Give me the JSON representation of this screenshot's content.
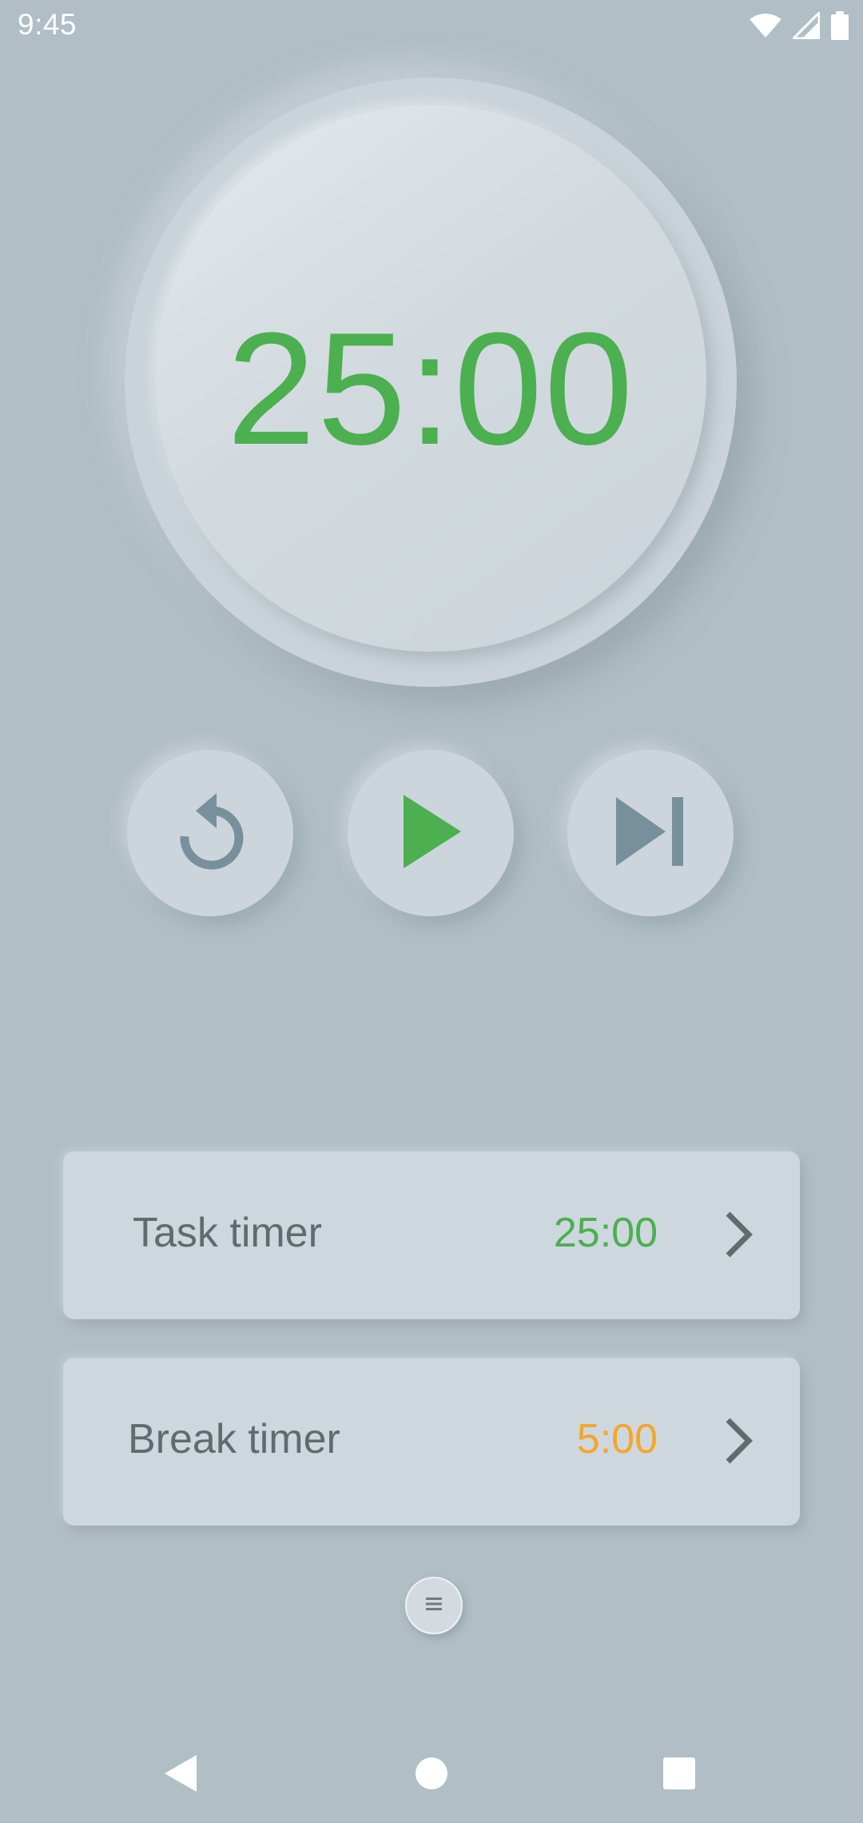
{
  "status_bar": {
    "time": "9:45",
    "icons": [
      "wifi-icon",
      "cellular-signal-icon",
      "battery-icon"
    ]
  },
  "dial": {
    "time": "25:00"
  },
  "controls": {
    "icons": [
      "reset-icon",
      "play-icon",
      "skip-next-icon"
    ]
  },
  "timers": [
    {
      "label": "Task timer",
      "value": "25:00",
      "value_color": "#4caf50"
    },
    {
      "label": "Break timer",
      "value": "5:00",
      "value_color": "#f4a62a"
    }
  ],
  "menu_handle": {
    "icon": "menu-icon"
  },
  "nav_bar": {
    "icons": [
      "back-icon",
      "home-icon",
      "recents-icon"
    ]
  },
  "colors": {
    "background": "#b1bec5",
    "accent_green": "#4caf50",
    "accent_orange": "#f4a62a",
    "icon_grey": "#78909c"
  }
}
